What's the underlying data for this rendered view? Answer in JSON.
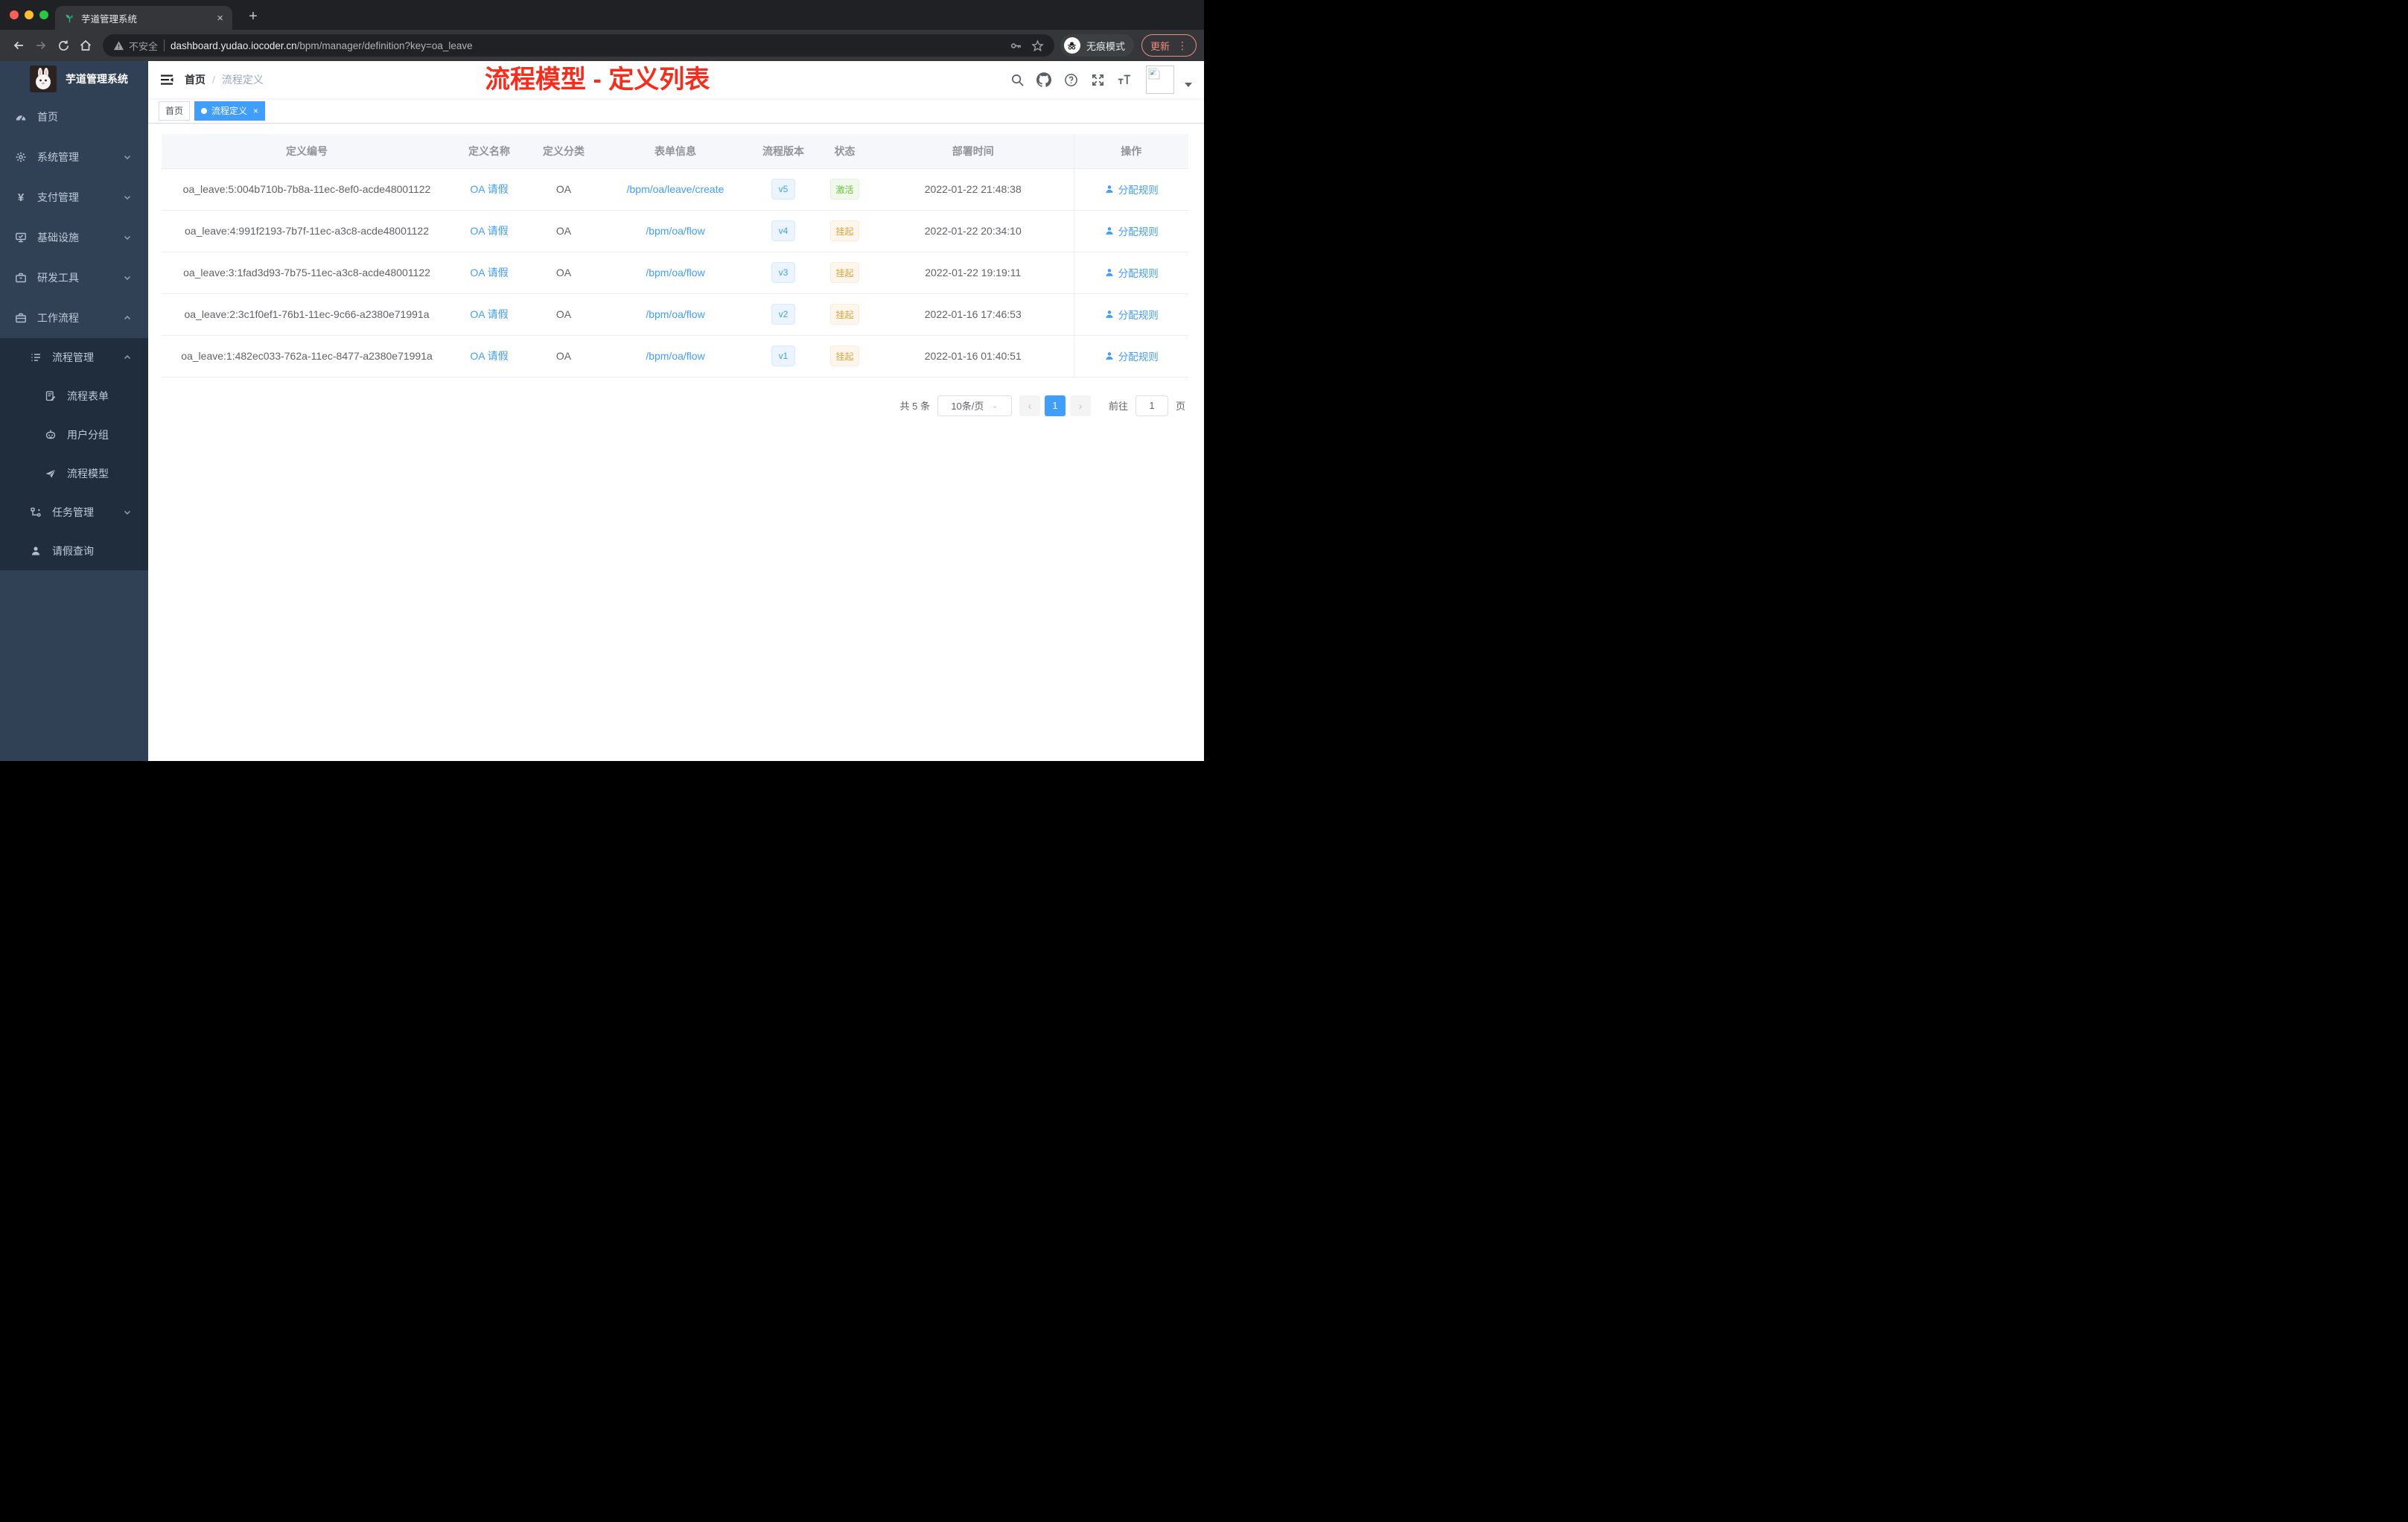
{
  "browser": {
    "tab": {
      "title": "芋道管理系统",
      "close_glyph": "×"
    },
    "new_tab_glyph": "+",
    "omnibox": {
      "security_label": "不安全",
      "url_domain": "dashboard.yudao.iocoder.cn",
      "url_path": "/bpm/manager/definition?key=oa_leave"
    },
    "incognito_label": "无痕模式",
    "update_button": {
      "label": "更新",
      "menu_glyph": "⋮"
    }
  },
  "sidebar": {
    "logo_title": "芋道管理系统",
    "items": [
      {
        "icon": "dashboard-icon",
        "label": "首页"
      },
      {
        "icon": "gear-icon",
        "label": "系统管理"
      },
      {
        "icon": "yen-icon",
        "label": "支付管理",
        "icon_glyph": "¥"
      },
      {
        "icon": "infrastructure-icon",
        "label": "基础设施"
      },
      {
        "icon": "dev-tools-icon",
        "label": "研发工具"
      },
      {
        "icon": "workflow-icon",
        "label": "工作流程"
      },
      {
        "icon": "process-manage-icon",
        "label": "流程管理"
      },
      {
        "icon": "process-form-icon",
        "label": "流程表单"
      },
      {
        "icon": "user-group-icon",
        "label": "用户分组"
      },
      {
        "icon": "process-model-icon",
        "label": "流程模型"
      },
      {
        "icon": "task-manage-icon",
        "label": "任务管理"
      },
      {
        "icon": "leave-query-icon",
        "label": "请假查询"
      }
    ]
  },
  "navbar": {
    "breadcrumb": {
      "home": "首页",
      "separator": "/",
      "current": "流程定义"
    },
    "annotation_title": "流程模型 - 定义列表"
  },
  "tags": {
    "items": [
      {
        "label": "首页"
      },
      {
        "label": "流程定义"
      }
    ],
    "close_glyph": "×"
  },
  "table": {
    "columns": [
      "定义编号",
      "定义名称",
      "定义分类",
      "表单信息",
      "流程版本",
      "状态",
      "部署时间",
      "操作"
    ],
    "action_label": "分配规则",
    "rows": [
      {
        "id": "oa_leave:5:004b710b-7b8a-11ec-8ef0-acde48001122",
        "name": "OA 请假",
        "category": "OA",
        "form": "/bpm/oa/leave/create",
        "version": "v5",
        "status": "激活",
        "status_type": "success",
        "deployed": "2022-01-22 21:48:38",
        "action": "分配规则"
      },
      {
        "id": "oa_leave:4:991f2193-7b7f-11ec-a3c8-acde48001122",
        "name": "OA 请假",
        "category": "OA",
        "form": "/bpm/oa/flow",
        "version": "v4",
        "status": "挂起",
        "status_type": "warning",
        "deployed": "2022-01-22 20:34:10",
        "action": "分配规则"
      },
      {
        "id": "oa_leave:3:1fad3d93-7b75-11ec-a3c8-acde48001122",
        "name": "OA 请假",
        "category": "OA",
        "form": "/bpm/oa/flow",
        "version": "v3",
        "status": "挂起",
        "status_type": "warning",
        "deployed": "2022-01-22 19:19:11",
        "action": "分配规则"
      },
      {
        "id": "oa_leave:2:3c1f0ef1-76b1-11ec-9c66-a2380e71991a",
        "name": "OA 请假",
        "category": "OA",
        "form": "/bpm/oa/flow",
        "version": "v2",
        "status": "挂起",
        "status_type": "warning",
        "deployed": "2022-01-16 17:46:53",
        "action": "分配规则"
      },
      {
        "id": "oa_leave:1:482ec033-762a-11ec-8477-a2380e71991a",
        "name": "OA 请假",
        "category": "OA",
        "form": "/bpm/oa/flow",
        "version": "v1",
        "status": "挂起",
        "status_type": "warning",
        "deployed": "2022-01-16 01:40:51",
        "action": "分配规则"
      }
    ]
  },
  "pagination": {
    "total_label": "共 5 条",
    "page_size_value": "10条/页",
    "prev_glyph": "‹",
    "current_page": "1",
    "next_glyph": "›",
    "goto_label": "前往",
    "goto_value": "1",
    "page_unit": "页"
  },
  "colors": {
    "accent_blue": "#409eff",
    "annotation_red": "#f92c1b",
    "sidebar_bg": "#304156",
    "sidebar_submenu_bg": "#1f2d3d",
    "status_active_text": "#67c23a",
    "status_active_bg": "#f0f9eb",
    "status_suspend_text": "#e6a23c",
    "status_suspend_bg": "#fdf6ec",
    "version_tag_bg": "#ecf5ff",
    "update_button_red": "#f28b82"
  }
}
